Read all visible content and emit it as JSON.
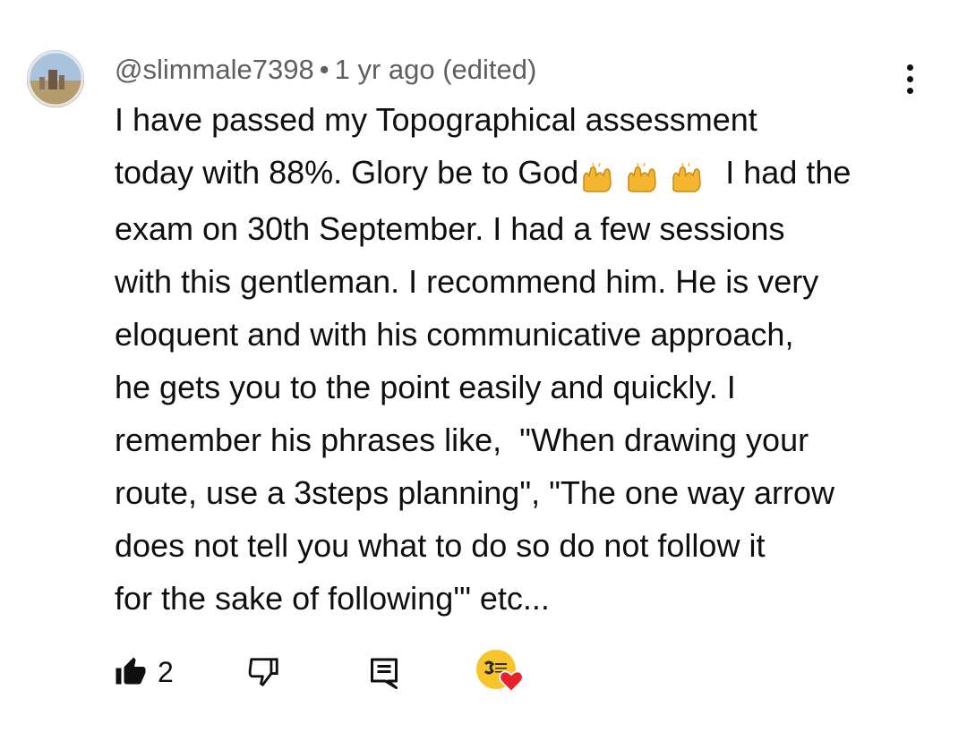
{
  "comment": {
    "author": "@slimmale7398",
    "separator": "•",
    "time": "1 yr ago (edited)",
    "text_part1": "I have passed my Topographical assessment\ntoday with 88%. Glory be to God",
    "text_part2": " I had the\nexam on 30th September. I had a few sessions\nwith this gentleman. I recommend him. He is very\neloquent and with his communicative approach,\nhe gets you to the point easily and quickly. I\nremember his phrases like,  \"When drawing your\nroute, use a 3steps planning\", \"The one way arrow\ndoes not tell you what to do so do not follow it\nfor the sake of following'\" etc...",
    "emoji": [
      "raising-hands",
      "raising-hands",
      "raising-hands"
    ]
  },
  "actions": {
    "like_count": "2",
    "icons": [
      "thumbs-up-icon",
      "thumbs-down-icon",
      "reply-icon",
      "more-vert-icon"
    ]
  },
  "colors": {
    "text": "#0f0f0f",
    "meta": "#5f5f5f",
    "heart": "#e8222b",
    "creator_avatar": "#f7c52b",
    "emoji": "#f4b531"
  }
}
